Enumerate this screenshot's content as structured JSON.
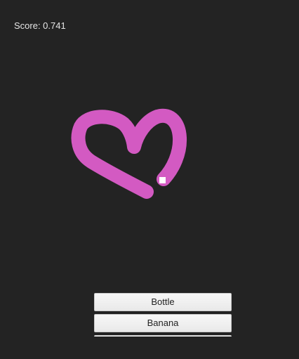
{
  "score_label": "Score: 0.741",
  "answers": [
    {
      "label": "Bottle"
    },
    {
      "label": "Banana"
    },
    {
      "label": ""
    }
  ],
  "drawing": {
    "stroke_color": "#d35ac2",
    "shape": "heart-doodle"
  },
  "colors": {
    "background": "#232323",
    "text": "#e6e6e6",
    "button_bg": "#eeeeee"
  }
}
